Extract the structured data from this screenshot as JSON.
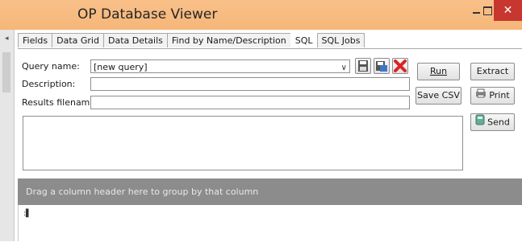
{
  "window": {
    "title": "OP Database Viewer"
  },
  "tabs": [
    "Fields",
    "Data Grid",
    "Data Details",
    "Find by Name/Description",
    "SQL",
    "SQL Jobs"
  ],
  "active_tab": "SQL",
  "form": {
    "query_name_label": "Query name:",
    "query_name_value": "[new query]",
    "description_label": "Description:",
    "description_value": "",
    "results_filename_label": "Results filename:",
    "results_filename_value": ""
  },
  "buttons": {
    "run": "Run",
    "extract": "Extract",
    "save_csv": "Save CSV",
    "print": "Print",
    "send": "Send"
  },
  "grid": {
    "group_hint": "Drag a column header here to group by that column",
    "row_indicator": ":▌"
  },
  "icons": [
    "save-icon",
    "save-as-icon",
    "delete-icon",
    "print-icon",
    "send-icon",
    "dropdown-arrow-icon",
    "minimize-icon",
    "maximize-icon",
    "close-icon"
  ],
  "colors": {
    "titlebar": "#f6b679",
    "close": "#c7372f",
    "group_bar": "#8c8c8c"
  }
}
